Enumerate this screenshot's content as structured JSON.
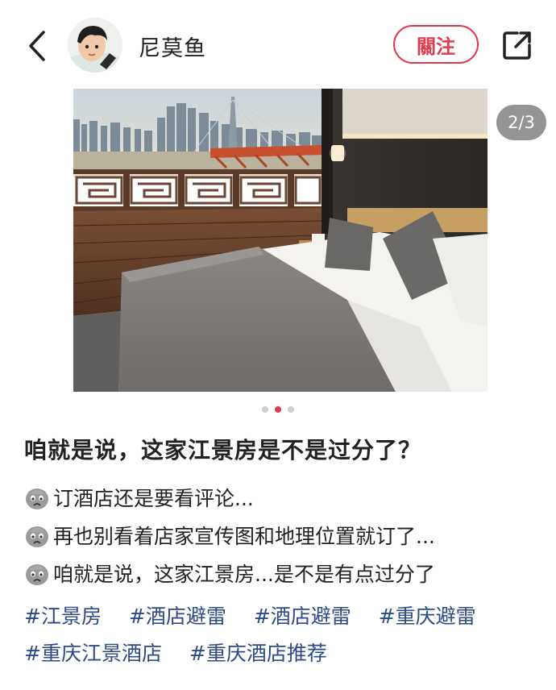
{
  "header": {
    "username": "尼莫鱼",
    "follow_label": "關注"
  },
  "photo": {
    "counter": "2/3",
    "current_index": 2,
    "total": 3
  },
  "post": {
    "title": "咱就是说，这家江景房是不是过分了？",
    "lines": [
      "订酒店还是要看评论...",
      "再也别看着店家宣传图和地理位置就订了...",
      "咱就是说，这家江景房...是不是有点过分了"
    ],
    "tags": [
      "#江景房",
      "#酒店避雷",
      "#酒店避雷",
      "#重庆避雷",
      "#重庆江景酒店",
      "#重庆酒店推荐"
    ]
  },
  "colors": {
    "accent": "#e03a4f",
    "tag": "#2c4a86"
  }
}
